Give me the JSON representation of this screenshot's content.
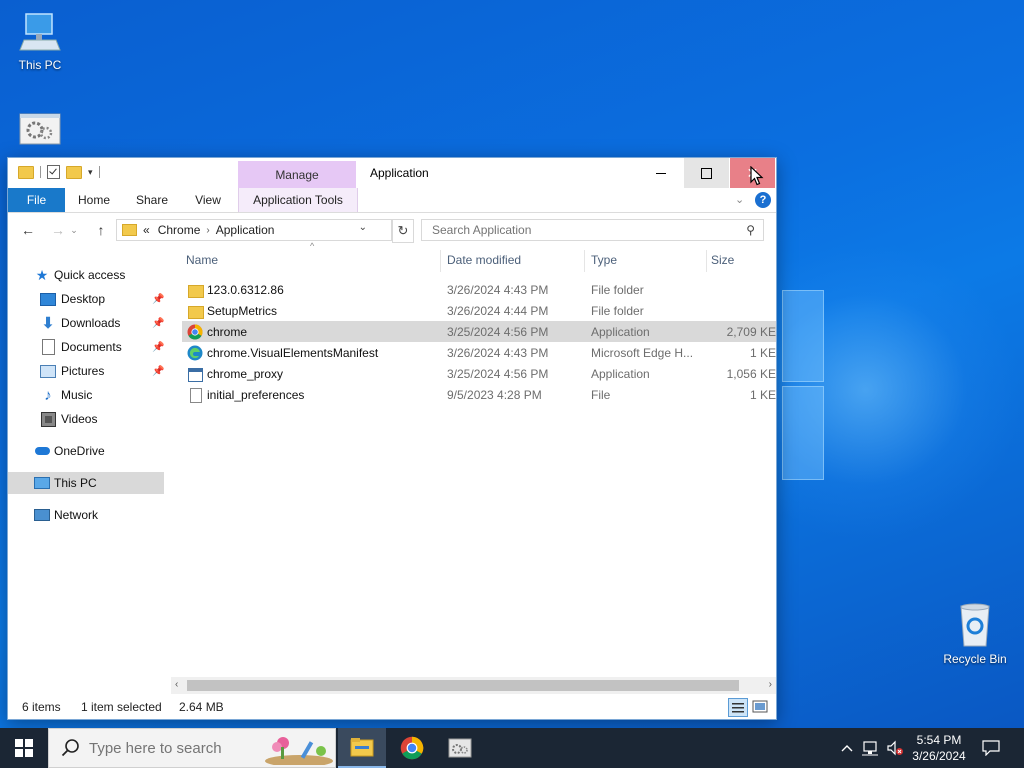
{
  "desktop": {
    "icons": {
      "this_pc": "This PC",
      "recycle_bin": "Recycle Bin"
    }
  },
  "window": {
    "title": "Application",
    "context_tab": "Manage",
    "ribbon_tabs": {
      "file": "File",
      "home": "Home",
      "share": "Share",
      "view": "View",
      "app_tools": "Application Tools"
    },
    "address": {
      "overflow": "«",
      "segments": [
        "Chrome",
        "Application"
      ]
    },
    "search_placeholder": "Search Application",
    "nav_pane": {
      "quick_access": "Quick access",
      "desktop": "Desktop",
      "downloads": "Downloads",
      "documents": "Documents",
      "pictures": "Pictures",
      "music": "Music",
      "videos": "Videos",
      "onedrive": "OneDrive",
      "this_pc": "This PC",
      "network": "Network"
    },
    "columns": {
      "name": "Name",
      "date": "Date modified",
      "type": "Type",
      "size": "Size"
    },
    "files": [
      {
        "name": "123.0.6312.86",
        "date": "3/26/2024 4:43 PM",
        "type": "File folder",
        "size": "",
        "icon": "folder-icon"
      },
      {
        "name": "SetupMetrics",
        "date": "3/26/2024 4:44 PM",
        "type": "File folder",
        "size": "",
        "icon": "folder-icon"
      },
      {
        "name": "chrome",
        "date": "3/25/2024 4:56 PM",
        "type": "Application",
        "size": "2,709 KE",
        "icon": "chrome-icon"
      },
      {
        "name": "chrome.VisualElementsManifest",
        "date": "3/26/2024 4:43 PM",
        "type": "Microsoft Edge H...",
        "size": "1 KE",
        "icon": "edge-icon"
      },
      {
        "name": "chrome_proxy",
        "date": "3/25/2024 4:56 PM",
        "type": "Application",
        "size": "1,056 KE",
        "icon": "app-window-icon"
      },
      {
        "name": "initial_preferences",
        "date": "9/5/2023 4:28 PM",
        "type": "File",
        "size": "1 KE",
        "icon": "file-icon"
      }
    ],
    "status": {
      "items": "6 items",
      "selected": "1 item selected",
      "size": "2.64 MB"
    }
  },
  "taskbar": {
    "search_placeholder": "Type here to search",
    "clock_time": "5:54 PM",
    "clock_date": "3/26/2024"
  },
  "colors": {
    "accent": "#1979ca",
    "selection": "#d9d9d9",
    "close_hover": "#e88088",
    "manage_tab": "#e6c8f5"
  }
}
